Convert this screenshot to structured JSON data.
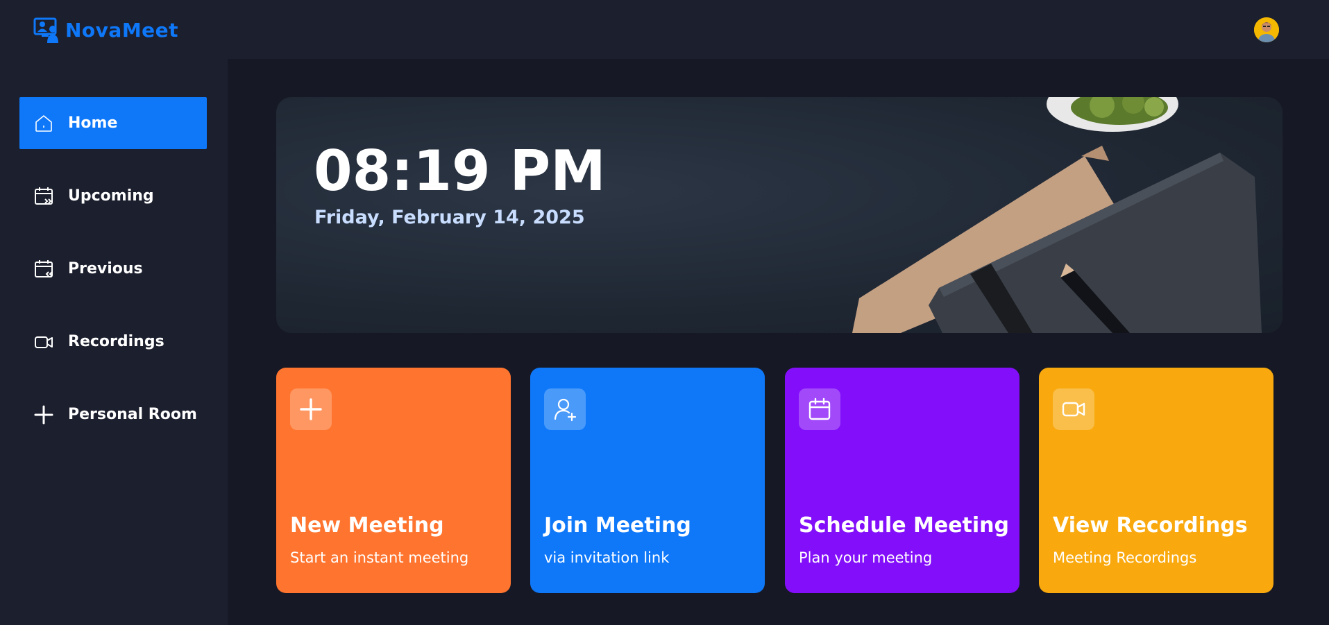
{
  "app": {
    "name": "NovaMeet",
    "logo_icon": "video-conference-icon",
    "avatar_icon": "user-avatar"
  },
  "colors": {
    "brand": "#0e78f9",
    "new_meeting": "#ff742e",
    "join_meeting": "#0e78f9",
    "schedule_meeting": "#830ef9",
    "view_recordings": "#f9a90e"
  },
  "sidebar": {
    "items": [
      {
        "label": "Home",
        "icon": "home-icon",
        "active": true
      },
      {
        "label": "Upcoming",
        "icon": "calendar-forward-icon",
        "active": false
      },
      {
        "label": "Previous",
        "icon": "calendar-back-icon",
        "active": false
      },
      {
        "label": "Recordings",
        "icon": "video-icon",
        "active": false
      },
      {
        "label": "Personal Room",
        "icon": "plus-icon",
        "active": false
      }
    ]
  },
  "hero": {
    "time": "08:19 PM",
    "date": "Friday, February 14, 2025"
  },
  "cards": [
    {
      "title": "New Meeting",
      "subtitle": "Start an instant meeting",
      "icon": "plus-icon"
    },
    {
      "title": "Join Meeting",
      "subtitle": "via invitation link",
      "icon": "add-user-icon"
    },
    {
      "title": "Schedule Meeting",
      "subtitle": "Plan your meeting",
      "icon": "calendar-icon"
    },
    {
      "title": "View Recordings",
      "subtitle": "Meeting Recordings",
      "icon": "video-icon"
    }
  ]
}
